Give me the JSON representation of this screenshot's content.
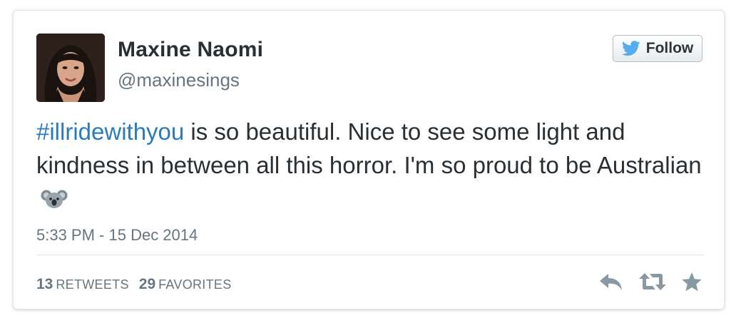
{
  "user": {
    "display_name": "Maxine Naomi",
    "screen_name": "@maxinesings"
  },
  "follow": {
    "label": "Follow",
    "icon": "twitter-bird-icon"
  },
  "tweet": {
    "hashtag": "#illridewithyou",
    "text": " is so beautiful. Nice to see some light and kindness in between all this horror. I'm so proud to be Australian",
    "emoji": "koala-icon",
    "timestamp": "5:33 PM - 15 Dec 2014"
  },
  "stats": {
    "retweets_count": "13",
    "retweets_label": "RETWEETS",
    "favorites_count": "29",
    "favorites_label": "FAVORITES"
  },
  "actions": [
    "reply-icon",
    "retweet-icon",
    "favorite-icon"
  ],
  "colors": {
    "text": "#292f33",
    "muted": "#66757f",
    "link": "#2b7bb9",
    "bird": "#55acee",
    "icons": "#8899a6"
  }
}
